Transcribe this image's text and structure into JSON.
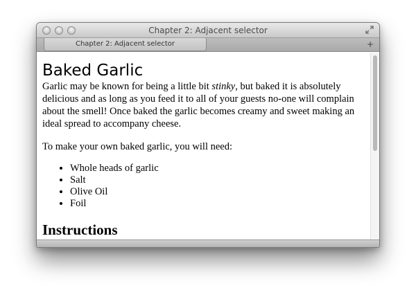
{
  "window": {
    "title": "Chapter 2: Adjacent selector"
  },
  "tabs": [
    {
      "label": "Chapter 2: Adjacent selector",
      "active": true
    }
  ],
  "toolbar": {
    "new_tab_glyph": "+",
    "new_tab_icon": "new-tab-icon"
  },
  "page": {
    "title": "Baked Garlic",
    "intro_before": "Garlic may be known for being a little bit ",
    "intro_em": "stinky",
    "intro_after": ", but baked it is absolutely delicious and as long as you feed it to all of your guests no-one will complain about the smell! Once baked the garlic becomes creamy and sweet making an ideal spread to accompany cheese.",
    "need_text": "To make your own baked garlic, you will need:",
    "ingredients": [
      "Whole heads of garlic",
      "Salt",
      "Olive Oil",
      "Foil"
    ],
    "instructions_heading": "Instructions"
  }
}
